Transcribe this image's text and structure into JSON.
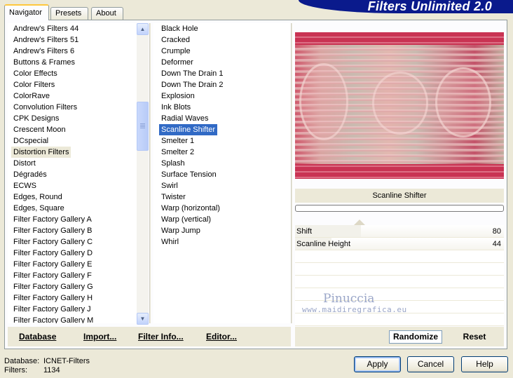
{
  "tabs": [
    "Navigator",
    "Presets",
    "About"
  ],
  "banner": "Filters Unlimited 2.0",
  "categories": [
    "Andrew's Filters 44",
    "Andrew's Filters 51",
    "Andrew's Filters 6",
    "Buttons & Frames",
    "Color Effects",
    "Color Filters",
    "ColorRave",
    "Convolution Filters",
    "CPK Designs",
    "Crescent Moon",
    "DCspecial",
    "Distortion Filters",
    "Distort",
    "Dégradés",
    "ECWS",
    "Edges, Round",
    "Edges, Square",
    "Filter Factory Gallery A",
    "Filter Factory Gallery B",
    "Filter Factory Gallery C",
    "Filter Factory Gallery D",
    "Filter Factory Gallery E",
    "Filter Factory Gallery F",
    "Filter Factory Gallery G",
    "Filter Factory Gallery H",
    "Filter Factory Gallery J",
    "Filter Factory Gallery M"
  ],
  "categories_selected": "Distortion Filters",
  "filters": [
    "Black Hole",
    "Cracked",
    "Crumple",
    "Deformer",
    "Down The Drain 1",
    "Down The Drain 2",
    "Explosion",
    "Ink Blots",
    "Radial Waves",
    "Scanline Shifter",
    "Smelter 1",
    "Smelter 2",
    "Splash",
    "Surface Tension",
    "Swirl",
    "Twister",
    "Warp (horizontal)",
    "Warp (vertical)",
    "Warp Jump",
    "Whirl"
  ],
  "filters_selected": "Scanline Shifter",
  "filter_name": "Scanline Shifter",
  "params": [
    {
      "name": "Shift",
      "value": "80",
      "level": 0.314
    },
    {
      "name": "Scanline Height",
      "value": "44",
      "level": 0.173
    }
  ],
  "watermark": {
    "name": "Pinuccia",
    "url": "www.maidiregrafica.eu"
  },
  "bottom_links": [
    "Database",
    "Import...",
    "Filter Info...",
    "Editor..."
  ],
  "right_buttons": {
    "randomize": "Randomize",
    "reset": "Reset"
  },
  "footer": {
    "database_label": "Database:",
    "database_value": "ICNET-Filters",
    "filters_label": "Filters:",
    "filters_value": "1134"
  },
  "dialog_buttons": {
    "apply": "Apply",
    "cancel": "Cancel",
    "help": "Help"
  },
  "colors": {
    "accent": "#316ac5",
    "banner": "#0a1a8c",
    "preview_bg": "#c93353"
  }
}
